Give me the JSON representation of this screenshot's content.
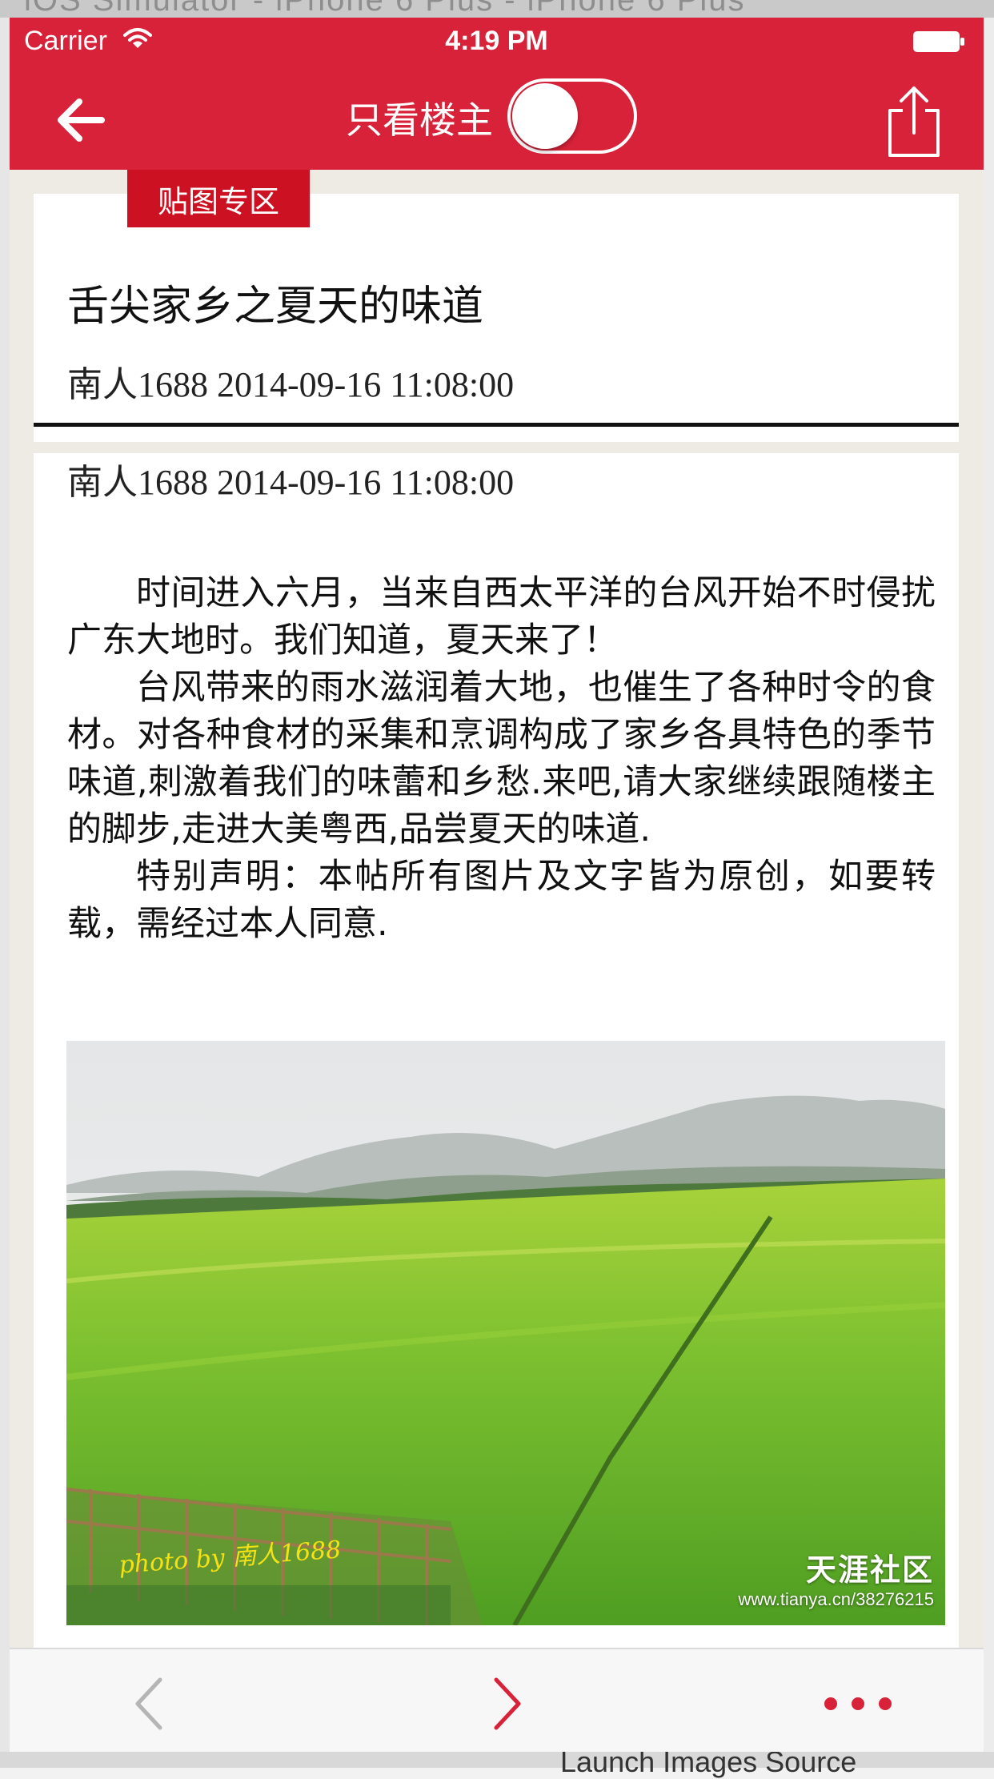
{
  "backdrop": {
    "top_text": "iOS Simulator - iPhone 6 Plus - iPhone 6 Plus",
    "bottom_text": "Launch Images Source"
  },
  "status_bar": {
    "carrier": "Carrier",
    "time": "4:19 PM"
  },
  "nav": {
    "title": "只看楼主",
    "toggle_on": false
  },
  "post": {
    "category": "贴图专区",
    "title": "舌尖家乡之夏天的味道",
    "author_date": "南人1688 2014-09-16 11:08:00",
    "floor_author_date": "南人1688 2014-09-16 11:08:00",
    "paragraphs": [
      "时间进入六月，当来自西太平洋的台风开始不时侵扰广东大地时。我们知道，夏天来了！",
      "台风带来的雨水滋润着大地，也催生了各种时令的食材。对各种食材的采集和烹调构成了家乡各具特色的季节味道,刺激着我们的味蕾和乡愁.来吧,请大家继续跟随楼主的脚步,走进大美粤西,品尝夏天的味道.",
      "特别声明：本帖所有图片及文字皆为原创，如要转载，需经过本人同意."
    ],
    "photo": {
      "credit": "photo by 南人1688",
      "watermark_brand": "天涯社区",
      "watermark_url": "www.tianya.cn/38276215"
    }
  },
  "colors": {
    "accent": "#d8223a",
    "tag": "#cc1122",
    "background": "#eeebe4"
  },
  "icons": {
    "back": "arrow-left-icon",
    "share": "share-icon",
    "prev": "chevron-left-icon",
    "next": "chevron-right-icon",
    "more": "more-dots-icon"
  }
}
